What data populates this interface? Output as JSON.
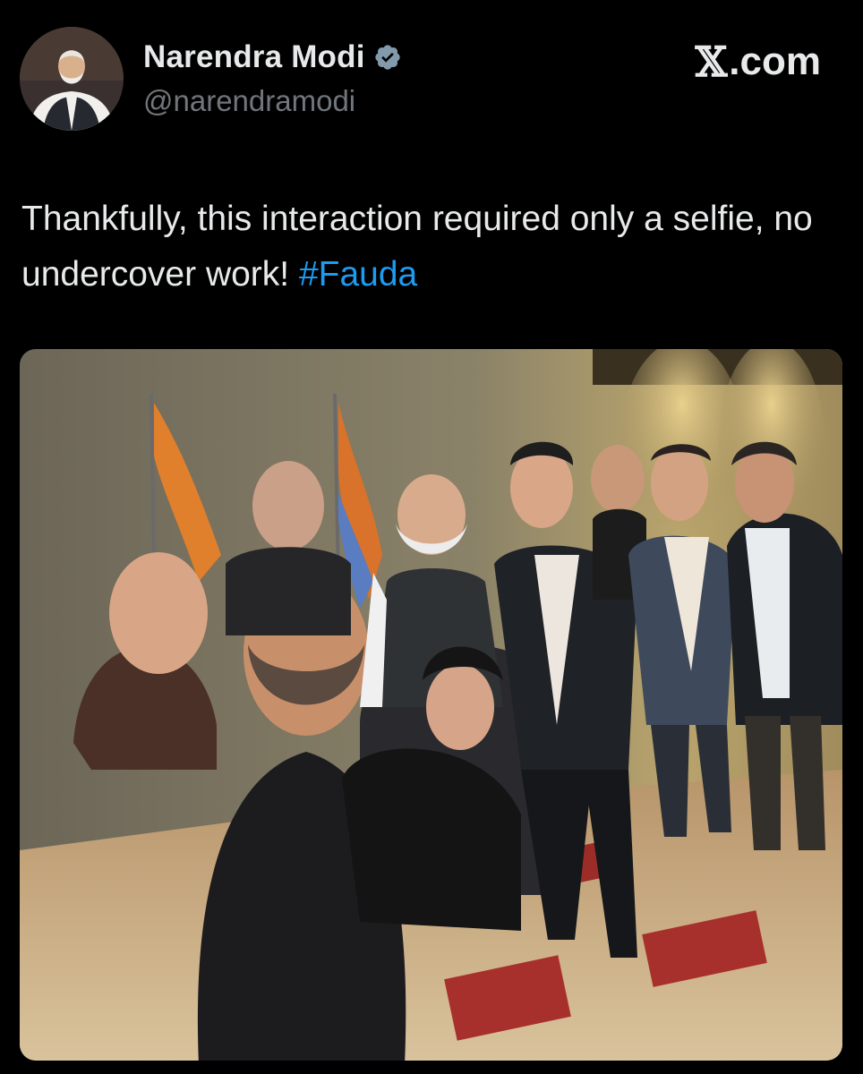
{
  "post": {
    "author": {
      "display_name": "Narendra Modi",
      "handle": "@narendramodi",
      "verified_icon": "verified-badge-icon"
    },
    "brand": {
      "x_glyph": "𝕏",
      "suffix": ".com"
    },
    "text": {
      "body": "Thankfully, this interaction required only a selfie, no undercover work! ",
      "hashtag": "#Fauda"
    },
    "media": {
      "kind": "photo",
      "description_icon": "group-selfie-photo"
    }
  },
  "colors": {
    "background": "#000000",
    "primary_text": "#e7e9ea",
    "secondary_text": "#71767b",
    "hashtag": "#1d9bf0",
    "verified_fill": "#829aab"
  }
}
